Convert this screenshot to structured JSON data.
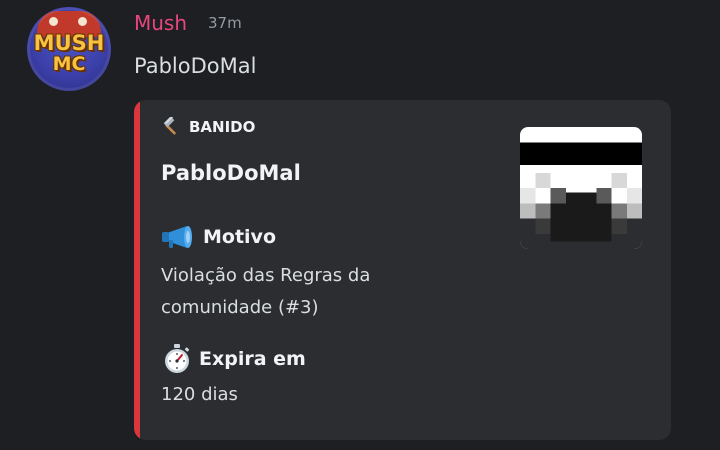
{
  "message": {
    "author": "Mush",
    "timestamp": "37m",
    "content": "PabloDoMal",
    "avatar": {
      "logo_lines": [
        "MUSH",
        "MC"
      ],
      "icon": "mushmc-logo"
    }
  },
  "embed": {
    "accent_color": "#da373c",
    "author": {
      "icon": "hammer-icon",
      "label": "BANIDO"
    },
    "title": "PabloDoMal",
    "fields": [
      {
        "icon": "megaphone-icon",
        "name": "Motivo",
        "value_lines": [
          "Violação das Regras da",
          "comunidade (#3)"
        ]
      },
      {
        "icon": "stopwatch-icon",
        "name": "Expira em",
        "value_lines": [
          "120 dias"
        ]
      }
    ],
    "thumbnail": {
      "icon": "minecraft-skin-head"
    }
  },
  "colors": {
    "background": "#1e1f22",
    "embed_background": "#2b2d31",
    "username": "#e8467c",
    "timestamp": "#949ba4"
  }
}
